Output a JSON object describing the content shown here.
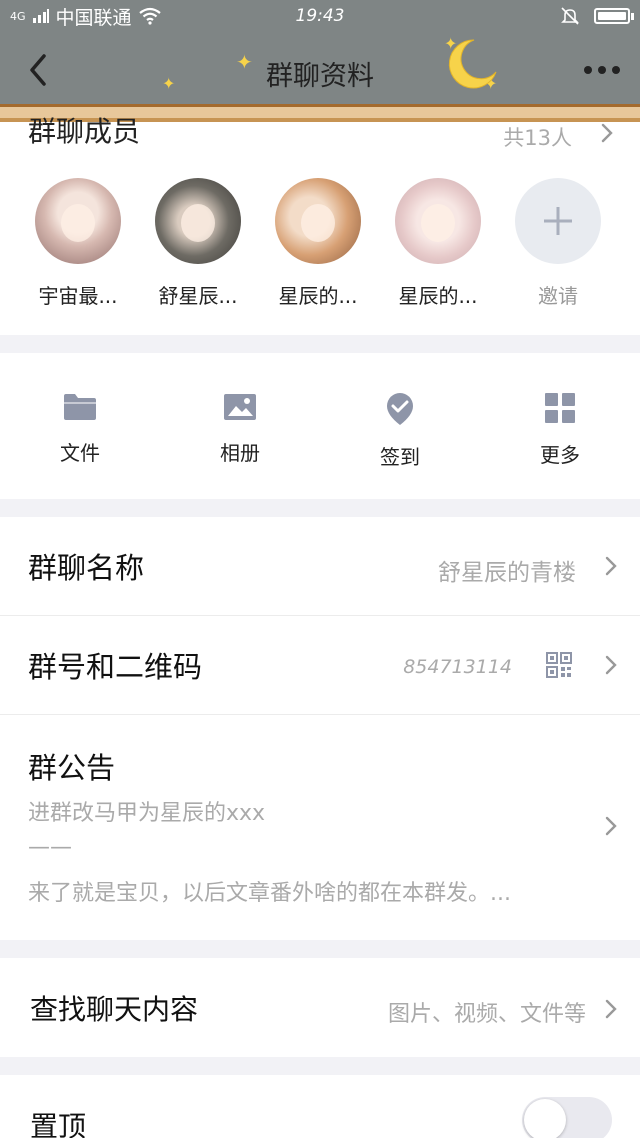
{
  "statusbar": {
    "network": "4G",
    "carrier": "中国联通",
    "time": "19:43"
  },
  "navbar": {
    "title": "群聊资料"
  },
  "members": {
    "heading": "群聊成员",
    "count": "共13人",
    "items": [
      {
        "name": "宇宙最..."
      },
      {
        "name": "舒星辰..."
      },
      {
        "name": "星辰的..."
      },
      {
        "name": "星辰的..."
      }
    ],
    "invite_label": "邀请"
  },
  "actions": [
    {
      "label": "文件",
      "icon": "folder-icon"
    },
    {
      "label": "相册",
      "icon": "image-icon"
    },
    {
      "label": "签到",
      "icon": "checkin-icon"
    },
    {
      "label": "更多",
      "icon": "grid-icon"
    }
  ],
  "group_name": {
    "label": "群聊名称",
    "value": "舒星辰的青楼"
  },
  "group_id": {
    "label": "群号和二维码",
    "value": "854713114"
  },
  "notice": {
    "label": "群公告",
    "lines": [
      "进群改马甲为星辰的xxx",
      "——",
      "来了就是宝贝，以后文章番外啥的都在本群发。..."
    ]
  },
  "search": {
    "label": "查找聊天内容",
    "value": "图片、视频、文件等"
  },
  "pin": {
    "label": "置顶",
    "enabled": false
  },
  "colors": {
    "navbar_bg": "#7f8585",
    "accent_icon": "#8e95a8",
    "page_bg": "#f2f2f6"
  }
}
